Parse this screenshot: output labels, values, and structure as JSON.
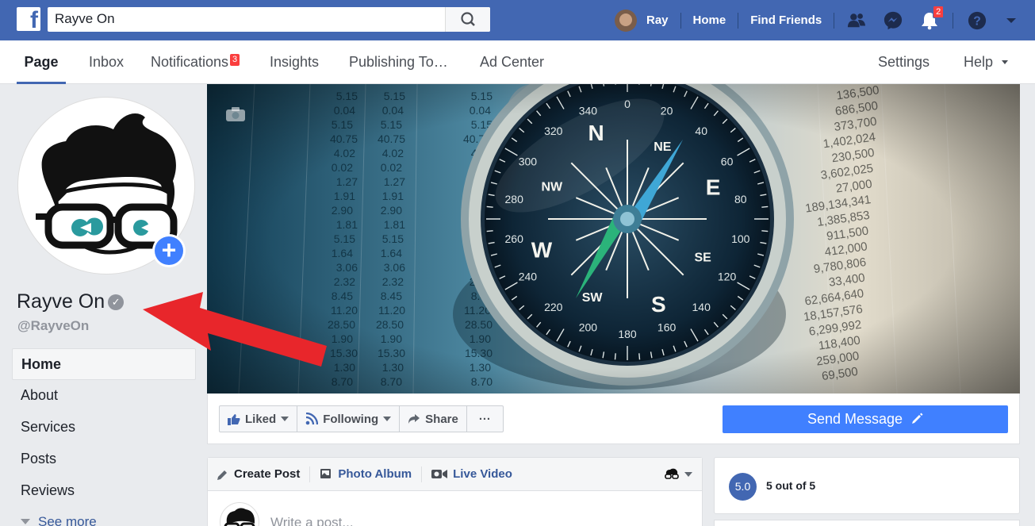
{
  "topbar": {
    "logo": "f",
    "search_value": "Rayve On",
    "user_name": "Ray",
    "home_label": "Home",
    "find_friends_label": "Find Friends",
    "notifications_count": "2"
  },
  "tabs": {
    "page": "Page",
    "inbox": "Inbox",
    "notifications": "Notifications",
    "notifications_count": "3",
    "insights": "Insights",
    "publishing": "Publishing To…",
    "ad_center": "Ad Center",
    "settings": "Settings",
    "help": "Help"
  },
  "page": {
    "name": "Rayve On",
    "handle": "@RayveOn",
    "verified_glyph": "✓"
  },
  "leftnav": {
    "items": [
      {
        "label": "Home"
      },
      {
        "label": "About"
      },
      {
        "label": "Services"
      },
      {
        "label": "Posts"
      },
      {
        "label": "Reviews"
      }
    ],
    "see_more": "See more"
  },
  "actions": {
    "liked": "Liked",
    "following": "Following",
    "share": "Share",
    "more": "···",
    "send_message": "Send Message"
  },
  "composer": {
    "create_post": "Create Post",
    "photo_album": "Photo Album",
    "live_video": "Live Video",
    "placeholder": "Write a post..."
  },
  "rating": {
    "score": "5.0",
    "text": "5 out of 5"
  },
  "cover": {
    "numbers_left": [
      "5.15",
      "0.04",
      "5.15",
      "40.75",
      "4.02",
      "0.02",
      "1.27",
      "1.91",
      "2.90",
      "1.81",
      "5.15",
      "1.64",
      "3.06",
      "2.32",
      "8.45",
      "11.20",
      "28.50",
      "1.90",
      "15.30",
      "1.30",
      "8.70"
    ],
    "numbers_right": [
      "136,500",
      "686,500",
      "373,700",
      "1,402,024",
      "230,500",
      "3,602,025",
      "27,000",
      "189,134,341",
      "1,385,853",
      "911,500",
      "412,000",
      "9,780,806",
      "33,400",
      "62,664,640",
      "18,157,576",
      "6,299,992",
      "118,400",
      "259,000",
      "69,500"
    ],
    "compass_letters": [
      "N",
      "E",
      "SE",
      "S",
      "SW",
      "W",
      "NW",
      "NE"
    ]
  },
  "colors": {
    "brand": "#4267b2",
    "accent": "#4080ff",
    "badge": "#fa3e3e",
    "arrow": "#e8262b"
  }
}
